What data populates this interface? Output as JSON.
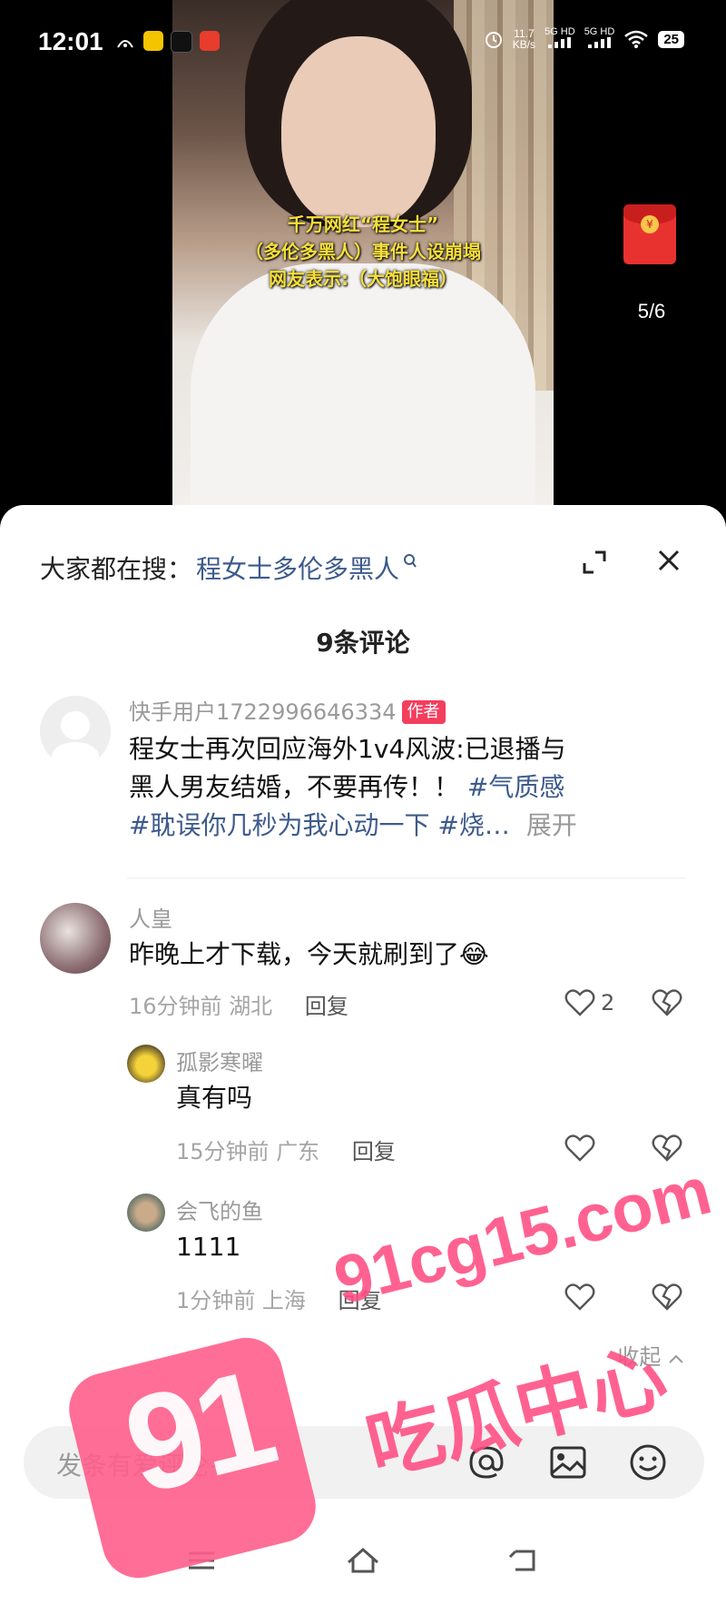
{
  "status_bar": {
    "time": "12:01",
    "net_speed_value": "11.7",
    "net_speed_unit": "KB/s",
    "sim1": "5G HD",
    "sim2": "5G HD",
    "battery": "25"
  },
  "video": {
    "caption_line1": "千万网红“程女士”",
    "caption_line2": "（多伦多黑人）事件人设崩塌",
    "caption_line3": "网友表示:（大饱眼福）",
    "page_indicator": "5/6",
    "redpacket_icon": "red-envelope"
  },
  "sheet": {
    "search_prefix": "大家都在搜：",
    "search_term": "程女士多伦多黑人",
    "comment_count": "9条评论"
  },
  "comments": [
    {
      "username": "快手用户1722996646334",
      "tag": "作者",
      "text_line1": "程女士再次回应海外1v4风波:已退播与",
      "text_line2_plain": "黑人男友结婚，不要再传！！",
      "hashtag1": "#气质感",
      "hashtag2": "#耽误你几秒为我心动一下",
      "hashtag3": "#烧…",
      "expand": "展开"
    },
    {
      "username": "人皇",
      "text": "昨晚上才下载，今天就刷到了",
      "emoji": "😂",
      "time": "16分钟前",
      "location": "湖北",
      "reply": "回复",
      "likes": "2"
    }
  ],
  "replies": [
    {
      "username": "孤影寒曜",
      "text": "真有吗",
      "time": "15分钟前",
      "location": "广东",
      "reply": "回复"
    },
    {
      "username": "会飞的鱼",
      "text": "1111",
      "time": "1分钟前",
      "location": "上海",
      "reply": "回复"
    }
  ],
  "collapse": "收起",
  "input": {
    "placeholder": "发条有爱评论~"
  },
  "watermark": {
    "badge": "91",
    "domain": "91cg15.com",
    "title": "吃瓜中心"
  },
  "colors": {
    "link_blue": "#3d5a8c",
    "author_tag": "#f43e5e",
    "watermark_pink": "#ff4d82"
  }
}
